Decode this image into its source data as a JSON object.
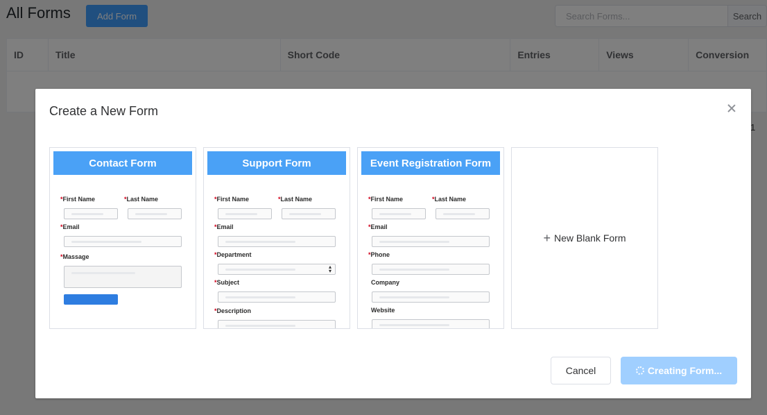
{
  "page": {
    "title": "All Forms",
    "add_form_label": "Add Form",
    "search": {
      "placeholder": "Search Forms...",
      "button_label": "Search"
    },
    "table": {
      "columns": [
        "ID",
        "Title",
        "Short Code",
        "Entries",
        "Views",
        "Conversion"
      ]
    },
    "pager": "1"
  },
  "dialog": {
    "title": "Create a New Form",
    "templates": [
      {
        "title": "Contact Form",
        "fields": [
          {
            "label": "First Name",
            "required": true
          },
          {
            "label": "Last Name",
            "required": true
          },
          {
            "label": "Email",
            "required": true
          },
          {
            "label": "Massage",
            "required": true
          }
        ]
      },
      {
        "title": "Support Form",
        "fields": [
          {
            "label": "First Name",
            "required": true
          },
          {
            "label": "Last Name",
            "required": true
          },
          {
            "label": "Email",
            "required": true
          },
          {
            "label": "Department",
            "required": true
          },
          {
            "label": "Subject",
            "required": true
          },
          {
            "label": "Description",
            "required": true
          }
        ]
      },
      {
        "title": "Event Registration Form",
        "fields": [
          {
            "label": "First Name",
            "required": true
          },
          {
            "label": "Last Name",
            "required": true
          },
          {
            "label": "Email",
            "required": true
          },
          {
            "label": "Phone",
            "required": true
          },
          {
            "label": "Company",
            "required": false
          },
          {
            "label": "Website",
            "required": false
          }
        ]
      }
    ],
    "blank_form_label": "New Blank Form",
    "cancel_label": "Cancel",
    "create_label": "Creating Form...",
    "colors": {
      "accent": "#409eff",
      "card_header": "#4aa1f6",
      "creating_button": "#a0cfff",
      "required_mark": "#d0021b"
    }
  }
}
